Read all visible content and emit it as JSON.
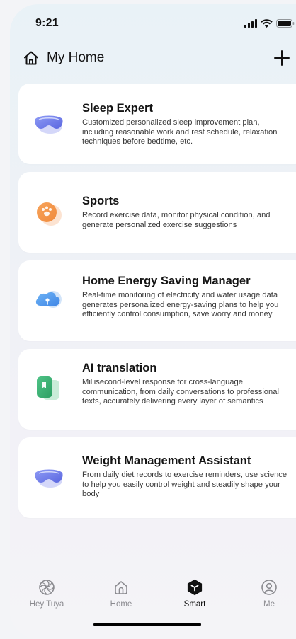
{
  "status_bar": {
    "time": "9:21"
  },
  "header": {
    "title": "My Home"
  },
  "cards": [
    {
      "title": "Sleep Expert",
      "desc": "Customized personalized sleep improvement plan, including reasonable work and rest schedule, relaxation techniques before bedtime, etc.",
      "icon": "sleep-mask-icon"
    },
    {
      "title": "Sports",
      "desc": "Record exercise data, monitor physical condition, and generate personalized exercise suggestions",
      "icon": "paw-icon"
    },
    {
      "title": "Home Energy Saving Manager",
      "desc": "Real-time monitoring of electricity and water usage data generates personalized energy-saving plans to help you efficiently control consumption, save worry and money",
      "icon": "cloud-icon"
    },
    {
      "title": "AI translation",
      "desc": "Millisecond-level response for cross-language communication, from daily conversations to professional texts, accurately delivering every layer of semantics",
      "icon": "translate-card-icon"
    },
    {
      "title": "Weight Management Assistant",
      "desc": "From daily diet records to exercise reminders, use science to help you easily control weight and steadily shape your body",
      "icon": "sleep-mask-icon"
    }
  ],
  "tabbar": {
    "items": [
      {
        "label": "Hey Tuya",
        "icon": "spiral-icon"
      },
      {
        "label": "Home",
        "icon": "home-icon"
      },
      {
        "label": "Smart",
        "icon": "smart-icon",
        "active": true
      },
      {
        "label": "Me",
        "icon": "profile-icon"
      }
    ]
  }
}
